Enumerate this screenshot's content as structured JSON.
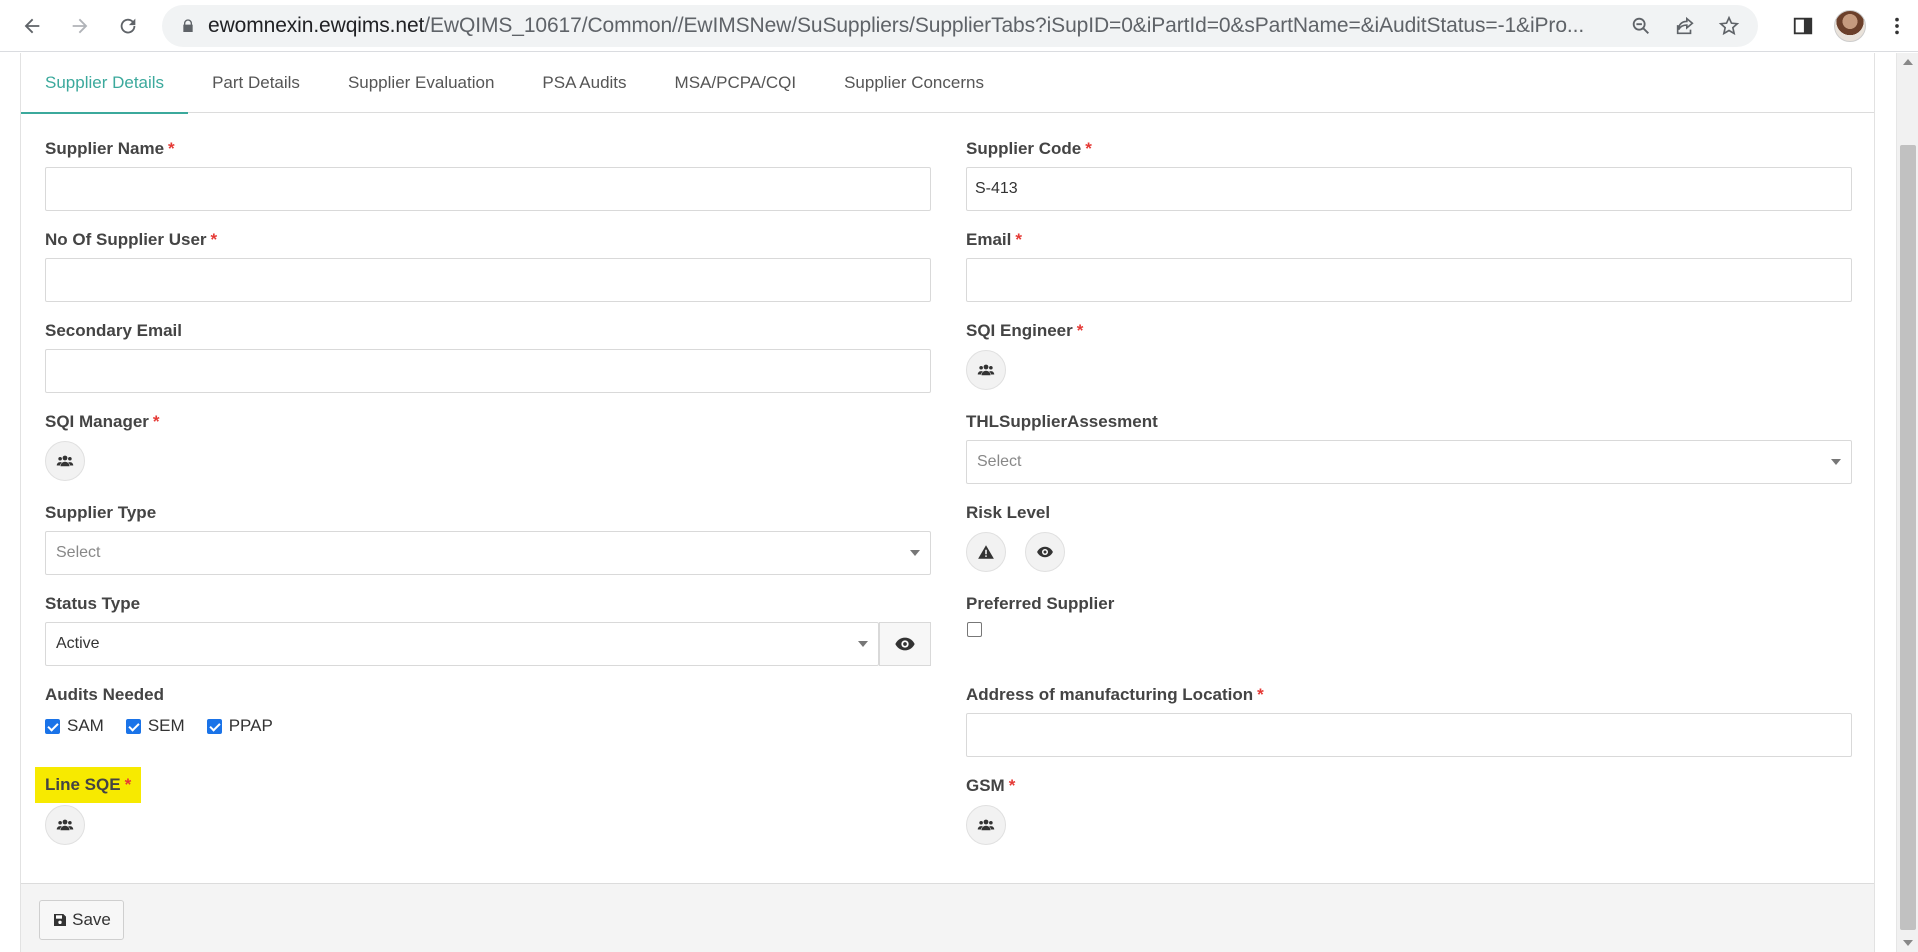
{
  "browser": {
    "url_host": "ewomnexin.ewqims.net",
    "url_path": "/EwQIMS_10617/Common//EwIMSNew/SuSuppliers/SupplierTabs?iSupID=0&iPartId=0&sPartName=&iAuditStatus=-1&iPro..."
  },
  "tabs": [
    {
      "label": "Supplier Details",
      "active": true
    },
    {
      "label": "Part Details"
    },
    {
      "label": "Supplier Evaluation"
    },
    {
      "label": "PSA Audits"
    },
    {
      "label": "MSA/PCPA/CQI"
    },
    {
      "label": "Supplier Concerns"
    }
  ],
  "form": {
    "supplier_name": {
      "label": "Supplier Name",
      "value": ""
    },
    "supplier_code": {
      "label": "Supplier Code",
      "value": "S-413"
    },
    "no_of_supplier_user": {
      "label": "No Of Supplier User",
      "value": ""
    },
    "email": {
      "label": "Email",
      "value": ""
    },
    "secondary_email": {
      "label": "Secondary Email",
      "value": ""
    },
    "sqi_engineer": {
      "label": "SQI Engineer"
    },
    "sqi_manager": {
      "label": "SQI Manager"
    },
    "thl_assessment": {
      "label": "THLSupplierAssesment",
      "placeholder": "Select"
    },
    "supplier_type": {
      "label": "Supplier Type",
      "placeholder": "Select"
    },
    "risk_level": {
      "label": "Risk Level"
    },
    "status_type": {
      "label": "Status Type",
      "value": "Active"
    },
    "preferred_supplier": {
      "label": "Preferred Supplier",
      "checked": false
    },
    "audits_needed": {
      "label": "Audits Needed",
      "options": [
        {
          "label": "SAM",
          "checked": true
        },
        {
          "label": "SEM",
          "checked": true
        },
        {
          "label": "PPAP",
          "checked": true
        }
      ]
    },
    "address": {
      "label": "Address of manufacturing Location",
      "value": ""
    },
    "line_sqe": {
      "label": "Line SQE"
    },
    "gsm": {
      "label": "GSM"
    },
    "required_mark": "*"
  },
  "footer": {
    "save_label": "Save"
  },
  "colors": {
    "accent": "#3ba99c",
    "required": "#e53935",
    "highlight": "#f7ea00",
    "checkbox": "#1a73e8"
  }
}
